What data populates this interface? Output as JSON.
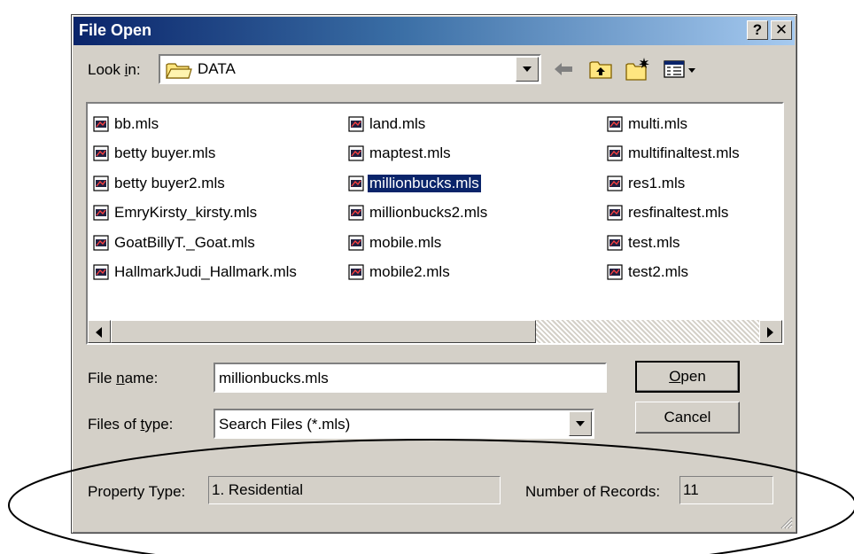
{
  "dialog": {
    "title": "File Open",
    "help_button": "?",
    "close_button": "✕"
  },
  "lookin": {
    "label_pre": "Look ",
    "label_key": "i",
    "label_post": "n:",
    "value": "DATA"
  },
  "toolbar": {
    "back_icon": "back-arrow-icon",
    "up_icon": "up-folder-icon",
    "new_folder_icon": "new-folder-icon",
    "view_icon": "view-menu-icon"
  },
  "files": {
    "col1": [
      "bb.mls",
      "betty buyer.mls",
      "betty buyer2.mls",
      "EmryKirsty_kirsty.mls",
      "GoatBillyT._Goat.mls",
      "HallmarkJudi_Hallmark.mls"
    ],
    "col2": [
      "land.mls",
      "maptest.mls",
      "millionbucks.mls",
      "millionbucks2.mls",
      "mobile.mls",
      "mobile2.mls"
    ],
    "col3": [
      "multi.mls",
      "multifinaltest.mls",
      "res1.mls",
      "resfinaltest.mls",
      "test.mls",
      "test2.mls"
    ],
    "selected": "millionbucks.mls"
  },
  "filename": {
    "label_pre": "File ",
    "label_key": "n",
    "label_post": "ame:",
    "value": "millionbucks.mls"
  },
  "filetype": {
    "label_pre": "Files of ",
    "label_key": "t",
    "label_post": "ype:",
    "value": "Search Files (*.mls)"
  },
  "buttons": {
    "open_key": "O",
    "open_rest": "pen",
    "cancel": "Cancel"
  },
  "status": {
    "property_label": "Property Type:",
    "property_value": "1. Residential",
    "records_label": "Number of Records:",
    "records_value": "11"
  }
}
